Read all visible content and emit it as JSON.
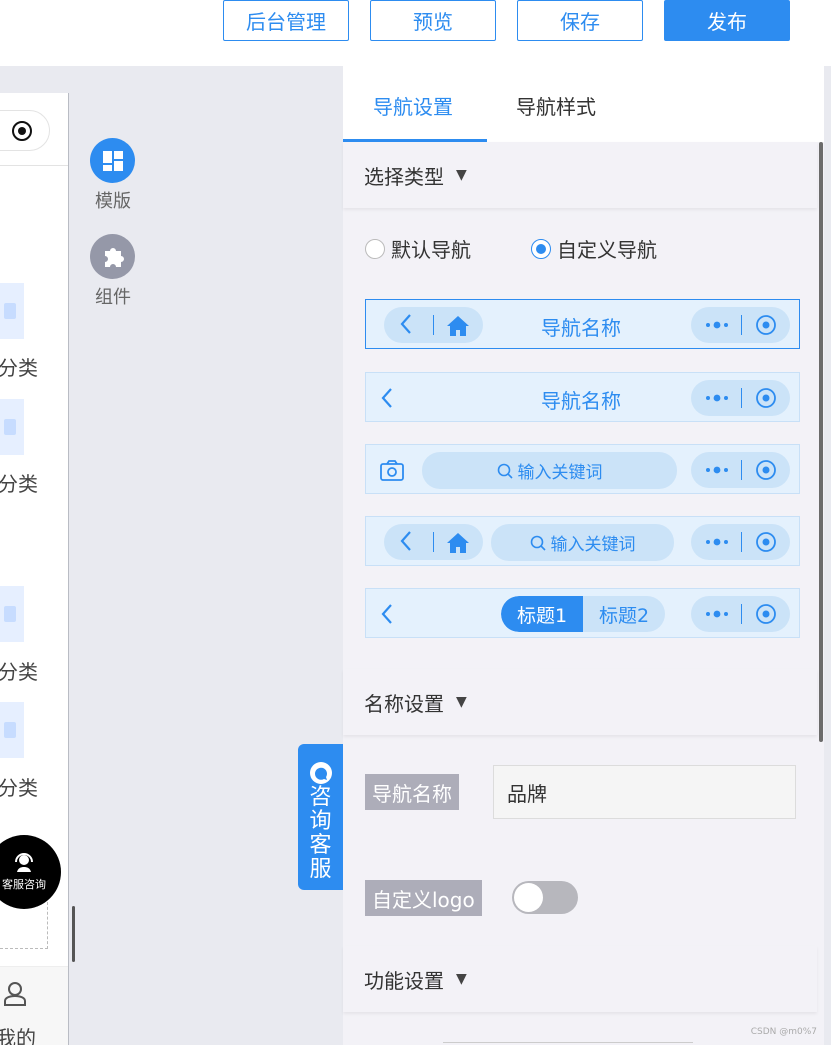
{
  "topbar": {
    "buttons": [
      "后台管理",
      "预览",
      "保存",
      "发布"
    ]
  },
  "preview": {
    "categories": [
      "分类",
      "分类",
      "分类",
      "分类"
    ],
    "cs_bubble": "客服咨询",
    "mine": "我的"
  },
  "tools": [
    {
      "label": "模版",
      "icon": "template-icon"
    },
    {
      "label": "组件",
      "icon": "puzzle-icon"
    }
  ],
  "consult": {
    "label": "咨询客服",
    "chars": [
      "咨",
      "询",
      "客",
      "服"
    ]
  },
  "panel": {
    "tabs": [
      {
        "label": "导航设置",
        "active": true
      },
      {
        "label": "导航样式",
        "active": false
      }
    ],
    "sections": {
      "type": "选择类型",
      "name": "名称设置",
      "func": "功能设置"
    },
    "radios": [
      {
        "label": "默认导航",
        "checked": false
      },
      {
        "label": "自定义导航",
        "checked": true
      }
    ],
    "nav_options": {
      "title": "导航名称",
      "search_placeholder": "输入关键词",
      "tab1": "标题1",
      "tab2": "标题2"
    },
    "name_field": {
      "label": "导航名称",
      "value": "品牌"
    },
    "logo_toggle": {
      "label": "自定义logo",
      "on": false
    }
  },
  "watermark": "CSDN @m0%7",
  "colors": {
    "accent": "#2d8cf0",
    "panel_bg": "#f3f2f7",
    "label_bg": "#adadb9"
  }
}
